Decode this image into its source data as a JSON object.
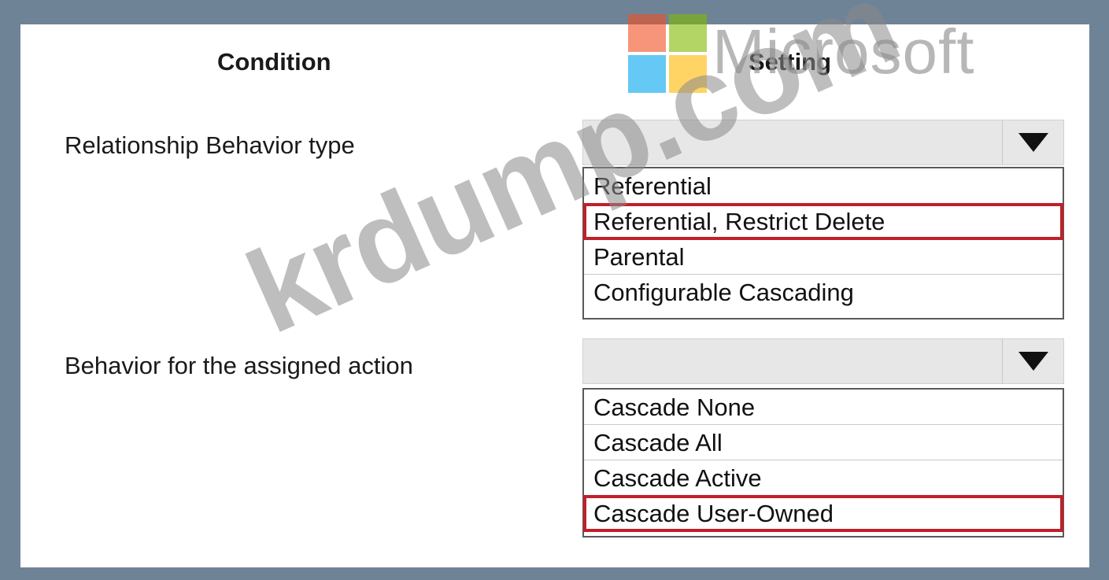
{
  "headers": {
    "condition": "Condition",
    "setting": "Setting"
  },
  "rows": [
    {
      "label": "Relationship Behavior type",
      "options": [
        "Referential",
        "Referential, Restrict Delete",
        "Parental",
        "Configurable Cascading"
      ],
      "selected_index": 1
    },
    {
      "label": "Behavior for the assigned action",
      "options": [
        "Cascade None",
        "Cascade All",
        "Cascade Active",
        "Cascade User-Owned"
      ],
      "selected_index": 3
    }
  ],
  "watermarks": {
    "brand": "Microsoft",
    "site": "krdump.com"
  },
  "colors": {
    "frame": "#6f8396",
    "selection_outline": "#c0202a",
    "logo": [
      "#f25022",
      "#7fba00",
      "#00a4ef",
      "#ffb900"
    ]
  }
}
